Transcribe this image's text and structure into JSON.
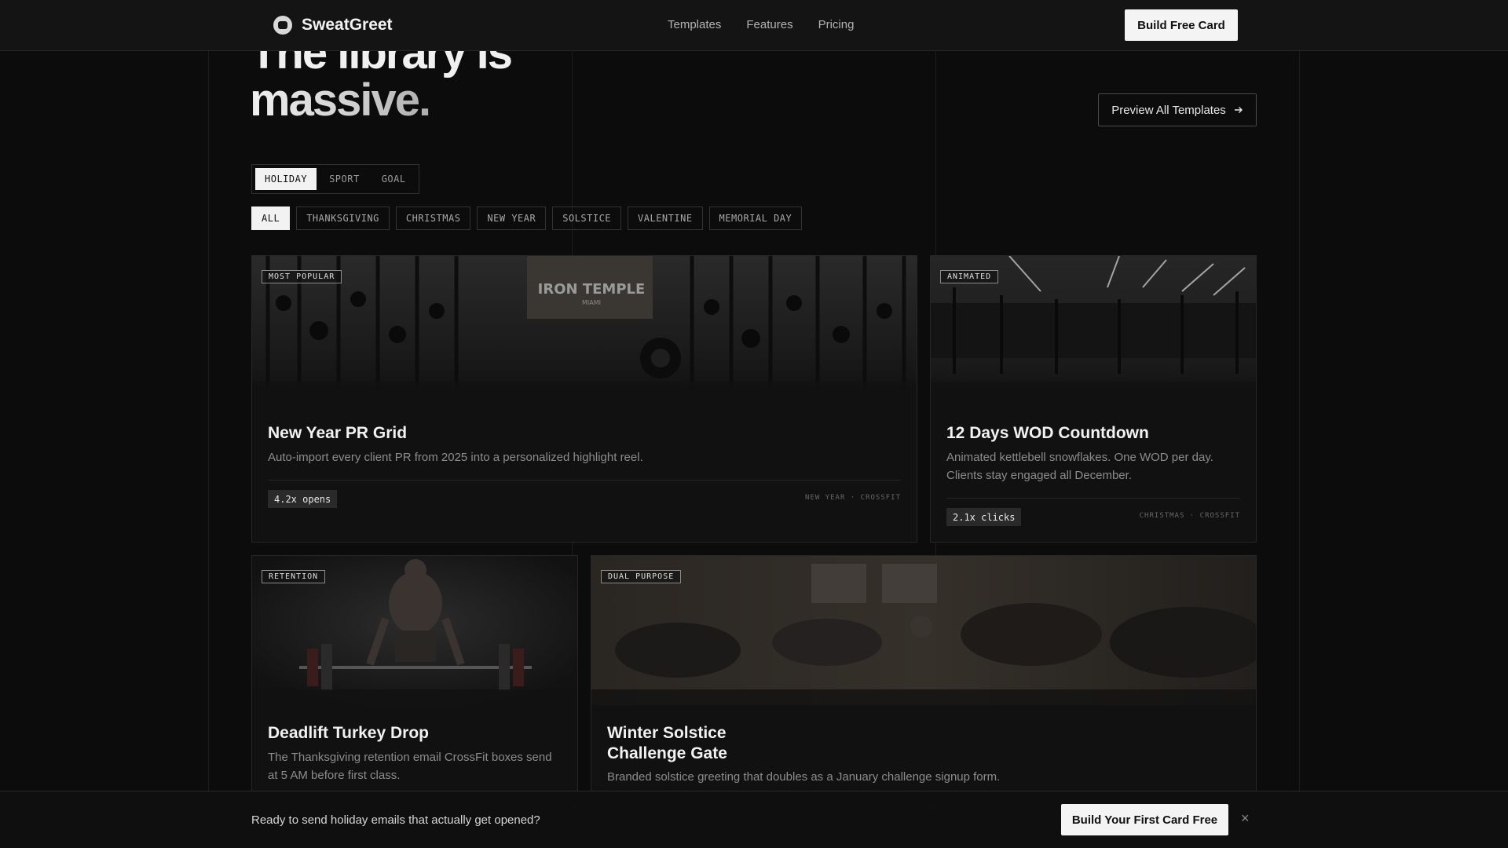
{
  "header": {
    "brand": "SweatGreet",
    "nav": [
      "Templates",
      "Features",
      "Pricing"
    ],
    "cta": "Build Free Card"
  },
  "hero": {
    "title_line1": "The library is",
    "title_line2": "massive.",
    "preview_button": "Preview All Templates"
  },
  "category_tabs": {
    "items": [
      "HOLIDAY",
      "SPORT",
      "GOAL"
    ],
    "active": "HOLIDAY"
  },
  "filters": {
    "items": [
      "ALL",
      "THANKSGIVING",
      "CHRISTMAS",
      "NEW YEAR",
      "SOLSTICE",
      "VALENTINE",
      "MEMORIAL DAY"
    ],
    "active": "ALL"
  },
  "cards": [
    {
      "badge": "MOST POPULAR",
      "image_sign": "IRON TEMPLE",
      "image_sign_sub": "MIAMI",
      "title": "New Year PR Grid",
      "desc": "Auto-import every client PR from 2025 into a personalized highlight reel.",
      "stat": "4.2x opens",
      "tags": "NEW YEAR · CROSSFIT"
    },
    {
      "badge": "ANIMATED",
      "title": "12 Days WOD Countdown",
      "desc": "Animated kettlebell snowflakes. One WOD per day. Clients stay engaged all December.",
      "stat": "2.1x clicks",
      "tags": "CHRISTMAS · CROSSFIT"
    },
    {
      "badge": "RETENTION",
      "title": "Deadlift Turkey Drop",
      "desc": "The Thanksgiving retention email CrossFit boxes send at 5 AM before first class."
    },
    {
      "badge": "DUAL PURPOSE",
      "title": "Winter Solstice Challenge Gate",
      "desc": "Branded solstice greeting that doubles as a January challenge signup form."
    }
  ],
  "bottom_bar": {
    "text": "Ready to send holiday emails that actually get opened?",
    "cta": "Build Your First Card Free",
    "close": "×"
  },
  "colors": {
    "background": "#0c0c0c",
    "header": "#141414",
    "accent_light": "#f4f4f4",
    "muted_text": "#8c8c8c"
  },
  "icons": [
    "brand-logo-icon",
    "arrow-right-icon",
    "close-icon"
  ]
}
